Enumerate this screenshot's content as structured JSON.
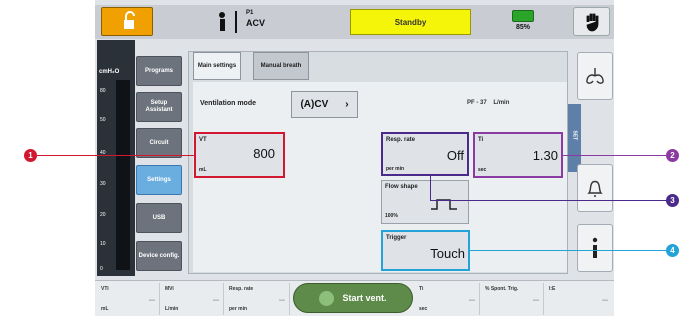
{
  "colors": {
    "lock": "#f0a000",
    "standby_bg": "#f5f50a",
    "active_nav": "#6aaee0",
    "start_button": "#5e8a4a",
    "callout_1": "#d21830",
    "callout_2": "#8a3aa0",
    "callout_3": "#4a2a8a",
    "callout_4": "#24a3d8"
  },
  "topbar": {
    "patient_icon": "adult-patient-icon",
    "patient_code": "P1",
    "mode": "ACV",
    "status": "Standby",
    "battery": "85%",
    "lock_icon": "unlock-icon",
    "hand_icon": "hand-stop-icon"
  },
  "bar_graph": {
    "unit": "cmH₂O",
    "ticks": [
      "80",
      "50",
      "40",
      "30",
      "20",
      "10",
      "0"
    ]
  },
  "nav": {
    "items": [
      {
        "label": "Programs"
      },
      {
        "label": "Setup Assistant"
      },
      {
        "label": "Circuit"
      },
      {
        "label": "Settings"
      },
      {
        "label": "USB"
      },
      {
        "label": "Device config."
      }
    ]
  },
  "tabs": [
    {
      "label": "Main settings"
    },
    {
      "label": "Manual breath"
    }
  ],
  "main": {
    "vent_mode_label": "Ventilation mode",
    "vent_mode_value": "(A)CV",
    "pf_text": "PF - 37",
    "pf_unit": "L/min",
    "vt": {
      "label": "VT",
      "value": "800",
      "unit": "mL"
    },
    "resp_rate": {
      "label": "Resp. rate",
      "value": "Off",
      "unit": "per min"
    },
    "ti": {
      "label": "Ti",
      "value": "1.30",
      "unit": "sec"
    },
    "flow_shape": {
      "label": "Flow shape",
      "value": "100%"
    },
    "trigger": {
      "label": "Trigger",
      "value": "Touch"
    }
  },
  "right": {
    "lungs_icon": "lungs-icon",
    "side_tab_label": "SET",
    "bell_icon": "bell-icon",
    "info_icon": "info-icon"
  },
  "bottom": {
    "cells": [
      {
        "label": "VTi",
        "unit": "mL",
        "value": "---"
      },
      {
        "label": "MVi",
        "unit": "L/min",
        "value": "---"
      },
      {
        "label": "Resp. rate",
        "unit": "per min",
        "value": "---"
      }
    ],
    "start_label": "Start vent.",
    "cells_right": [
      {
        "label": "Ti",
        "unit": "sec",
        "value": "---"
      },
      {
        "label": "% Spont. Trig.",
        "unit": "",
        "value": "---"
      },
      {
        "label": "I:E",
        "unit": "",
        "value": "---"
      }
    ]
  },
  "callouts": [
    "1",
    "2",
    "3",
    "4"
  ]
}
